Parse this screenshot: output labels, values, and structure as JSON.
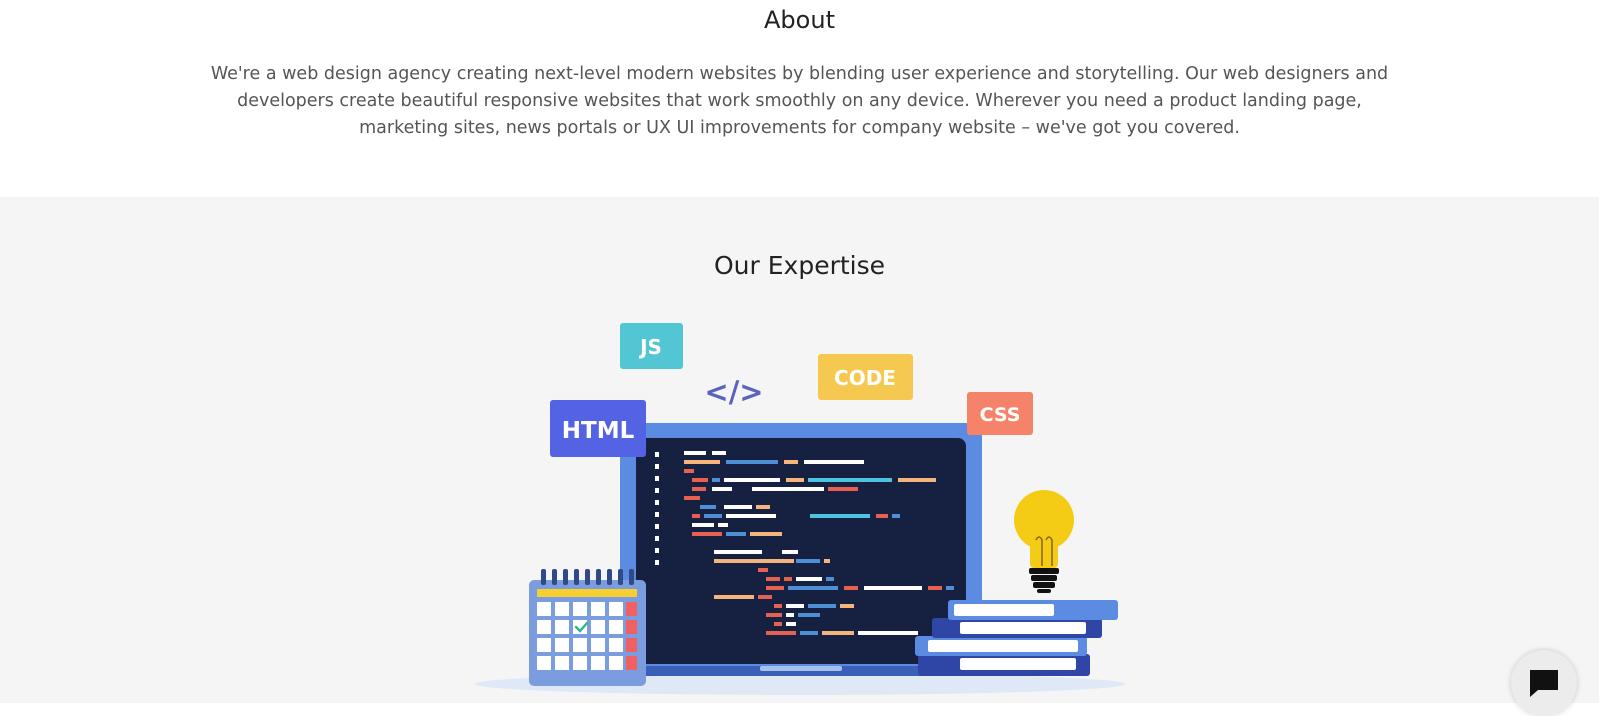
{
  "about": {
    "title": "About",
    "text": "We're a web design agency creating next-level modern websites by blending user experience and storytelling. Our web designers and developers create beautiful responsive websites that work smoothly on any device. Wherever you need a product landing page, marketing sites, news portals or UX UI improvements for company website – we've got you covered."
  },
  "expertise": {
    "title": "Our Expertise",
    "tags": {
      "js": "JS",
      "code": "CODE",
      "css": "CSS",
      "html": "HTML",
      "code_symbol": "</>"
    }
  },
  "colors": {
    "js_tag": "#52c6d3",
    "code_tag": "#f5c94f",
    "css_tag": "#f5836a",
    "html_tag": "#5463e3",
    "laptop_frame": "#5b8ce2",
    "screen": "#162040",
    "bulb": "#f5cc15",
    "section_bg": "#f5f5f5"
  },
  "icons": {
    "chat": "chat-icon",
    "checkmark": "check-icon",
    "bulb": "lightbulb-icon",
    "calendar": "calendar-icon"
  }
}
